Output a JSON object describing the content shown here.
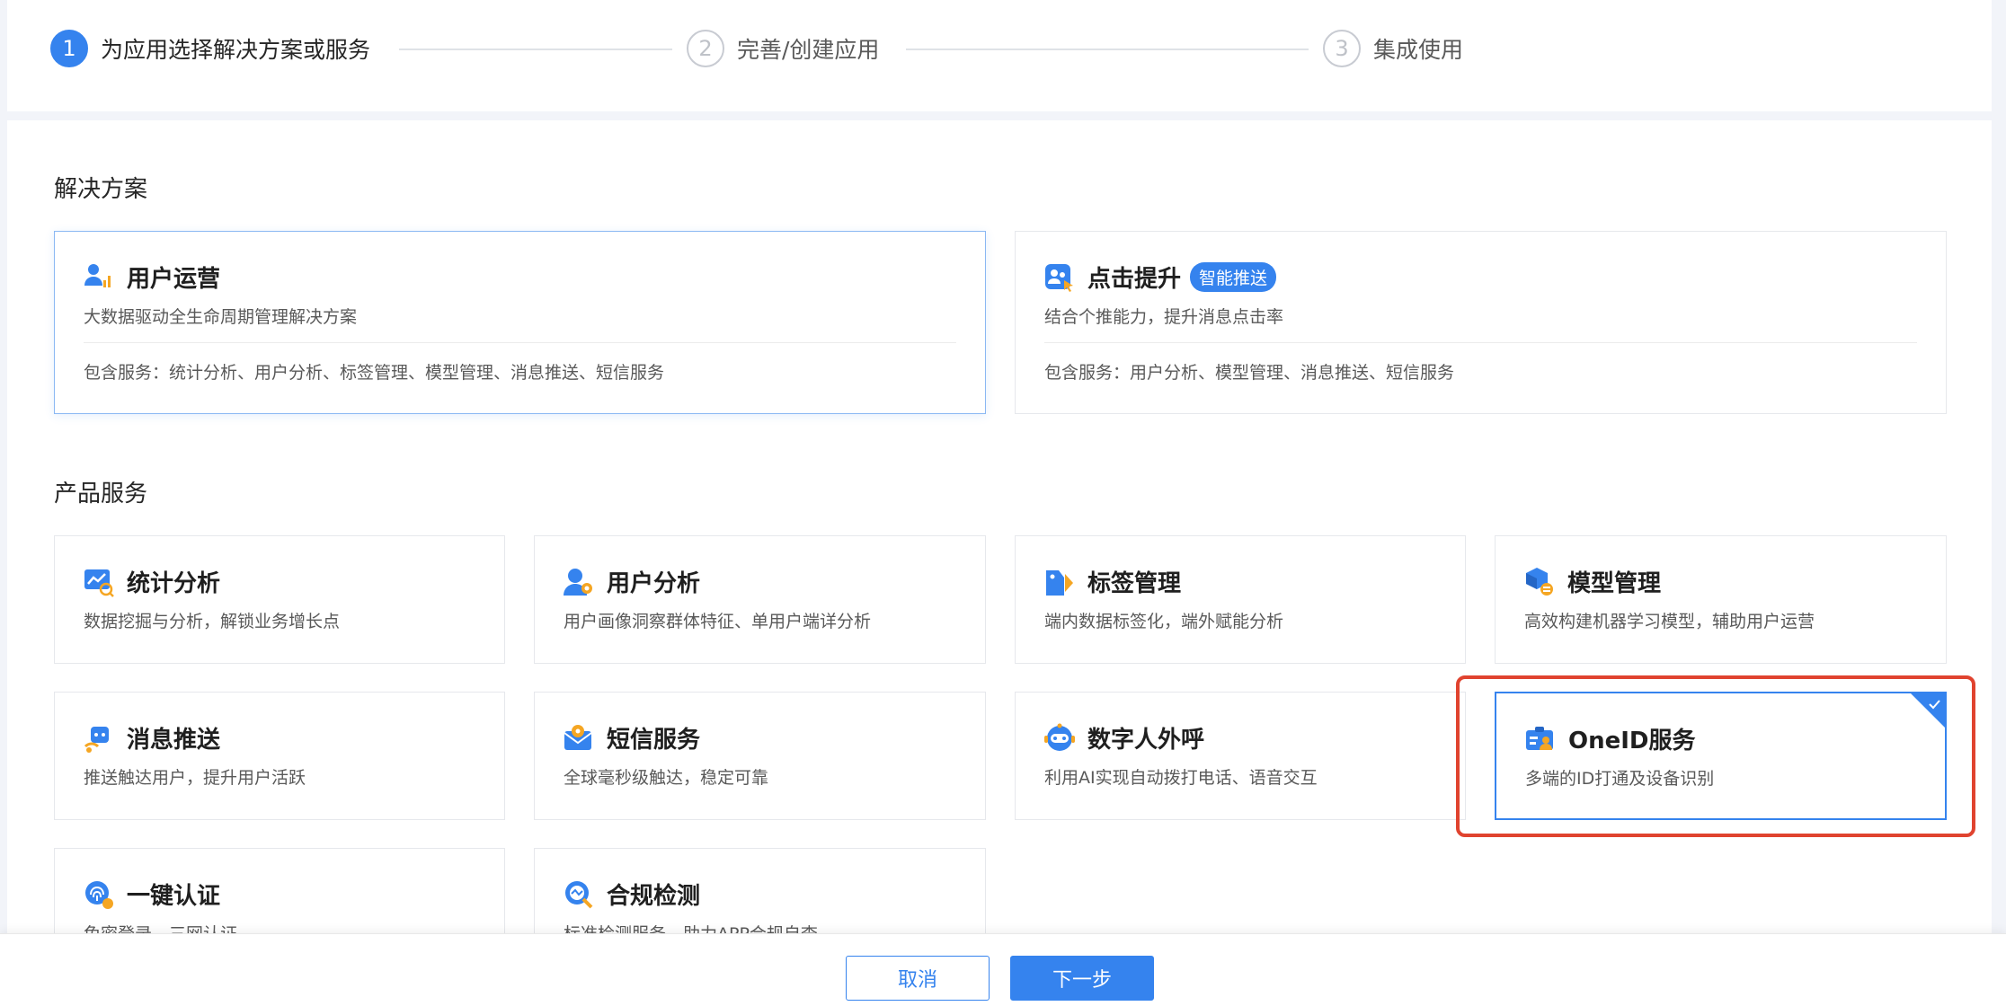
{
  "steps": [
    {
      "num": "1",
      "label": "为应用选择解决方案或服务"
    },
    {
      "num": "2",
      "label": "完善/创建应用"
    },
    {
      "num": "3",
      "label": "集成使用"
    }
  ],
  "solutions": {
    "title": "解决方案",
    "items": [
      {
        "title": "用户运营",
        "desc": "大数据驱动全生命周期管理解决方案",
        "services": "包含服务：统计分析、用户分析、标签管理、模型管理、消息推送、短信服务"
      },
      {
        "title": "点击提升",
        "badge": "智能推送",
        "desc": "结合个推能力，提升消息点击率",
        "services": "包含服务：用户分析、模型管理、消息推送、短信服务"
      }
    ]
  },
  "products": {
    "title": "产品服务",
    "items": [
      {
        "title": "统计分析",
        "desc": "数据挖掘与分析，解锁业务增长点"
      },
      {
        "title": "用户分析",
        "desc": "用户画像洞察群体特征、单用户端详分析"
      },
      {
        "title": "标签管理",
        "desc": "端内数据标签化，端外赋能分析"
      },
      {
        "title": "模型管理",
        "desc": "高效构建机器学习模型，辅助用户运营"
      },
      {
        "title": "消息推送",
        "desc": "推送触达用户，提升用户活跃"
      },
      {
        "title": "短信服务",
        "desc": "全球毫秒级触达，稳定可靠"
      },
      {
        "title": "数字人外呼",
        "desc": "利用AI实现自动拨打电话、语音交互"
      },
      {
        "title": "OneID服务",
        "desc": "多端的ID打通及设备识别"
      },
      {
        "title": "一键认证",
        "desc": "免密登录，三网认证"
      },
      {
        "title": "合规检测",
        "desc": "标准检测服务，助力APP合规自查"
      }
    ]
  },
  "footer": {
    "cancel": "取消",
    "next": "下一步"
  },
  "colors": {
    "primary": "#3583ee",
    "highlight": "#e0432f",
    "icon_accent": "#f5a623"
  }
}
